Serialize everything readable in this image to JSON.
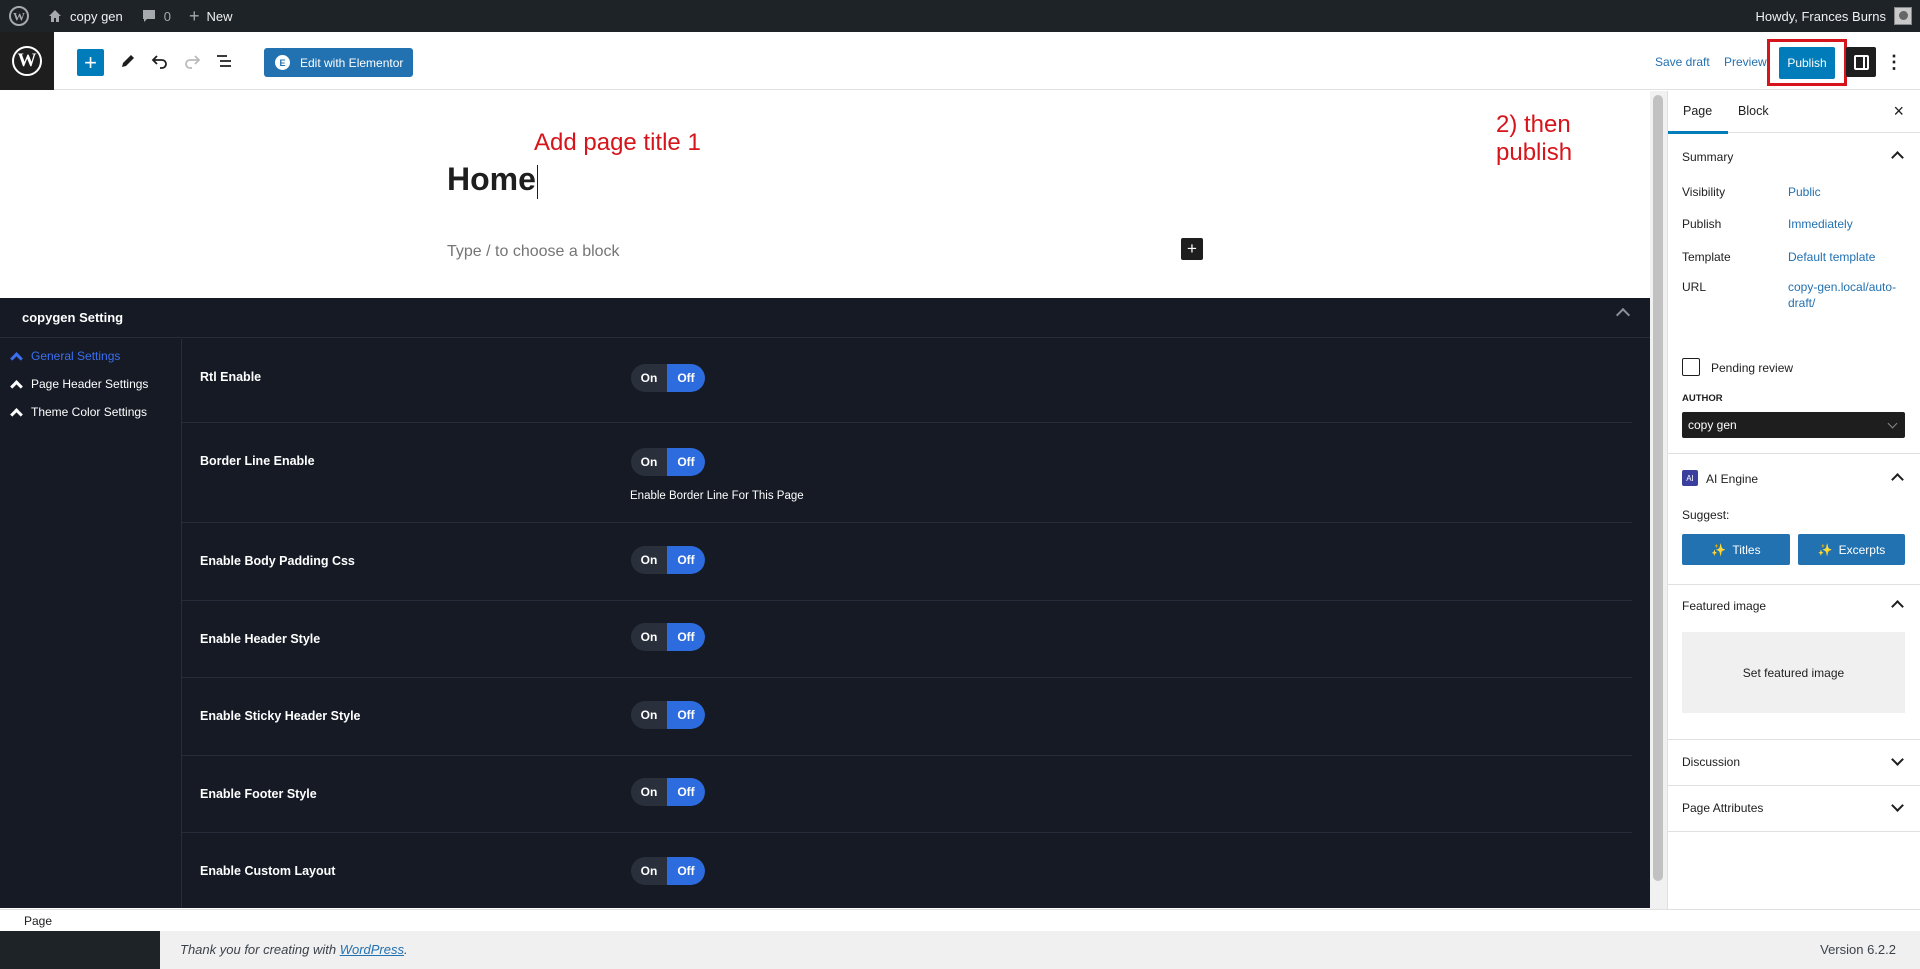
{
  "admin_bar": {
    "site_name": "copy gen",
    "comments_count": "0",
    "new_label": "New",
    "howdy": "Howdy, Frances Burns"
  },
  "toolbar": {
    "edit_elementor_label": "Edit with Elementor",
    "save_draft_label": "Save draft",
    "preview_label": "Preview",
    "publish_label": "Publish"
  },
  "annotations": {
    "title_hint": "Add page title  1",
    "publish_hint": "2) then publish"
  },
  "editor": {
    "page_title": "Home",
    "block_placeholder": "Type / to choose a block"
  },
  "settings_panel": {
    "title": "copygen Setting",
    "menu": [
      {
        "label": "General Settings",
        "active": true
      },
      {
        "label": "Page Header Settings",
        "active": false
      },
      {
        "label": "Theme Color Settings",
        "active": false
      }
    ],
    "toggle_on": "On",
    "toggle_off": "Off",
    "rows": [
      {
        "label": "Rtl Enable",
        "description": ""
      },
      {
        "label": "Border Line Enable",
        "description": "Enable Border Line For This Page"
      },
      {
        "label": "Enable Body Padding Css",
        "description": ""
      },
      {
        "label": "Enable Header Style",
        "description": ""
      },
      {
        "label": "Enable Sticky Header Style",
        "description": ""
      },
      {
        "label": "Enable Footer Style",
        "description": ""
      },
      {
        "label": "Enable Custom Layout",
        "description": ""
      }
    ]
  },
  "sidebar": {
    "tabs": [
      "Page",
      "Block"
    ],
    "summary": {
      "title": "Summary",
      "visibility_label": "Visibility",
      "visibility_value": "Public",
      "publish_label": "Publish",
      "publish_value": "Immediately",
      "template_label": "Template",
      "template_value": "Default template",
      "url_label": "URL",
      "url_value": "copy-gen.local/auto-draft/",
      "pending_review_label": "Pending review",
      "author_label": "AUTHOR",
      "author_value": "copy gen"
    },
    "ai_engine": {
      "title": "AI Engine",
      "suggest_label": "Suggest:",
      "titles_button": "Titles",
      "excerpts_button": "Excerpts"
    },
    "featured_image": {
      "title": "Featured image",
      "set_label": "Set featured image"
    },
    "discussion_label": "Discussion",
    "page_attributes_label": "Page Attributes"
  },
  "status_bar": {
    "breadcrumb": "Page"
  },
  "footer": {
    "thanks_prefix": "Thank you for creating with ",
    "thanks_link": "WordPress",
    "thanks_suffix": ".",
    "version": "Version 6.2.2"
  },
  "colors": {
    "accent": "#007cba",
    "annotation_red": "#d6141b",
    "settings_bg": "#151a25",
    "toggle_off": "#2d6cdf"
  }
}
